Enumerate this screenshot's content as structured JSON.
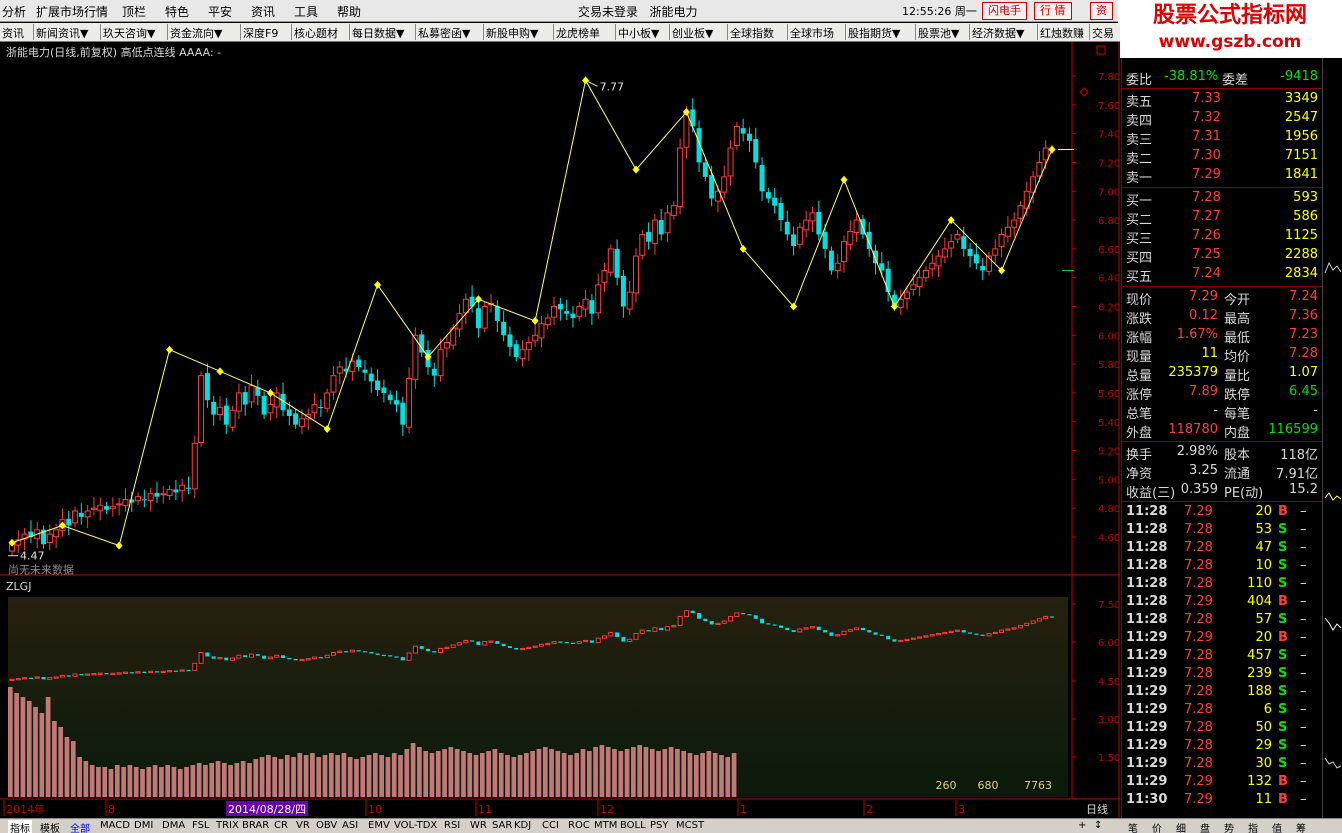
{
  "menu": {
    "items": [
      "分析",
      "扩展市场行情",
      "顶栏",
      "特色",
      "平安",
      "资讯",
      "工具",
      "帮助"
    ],
    "title": "交易未登录",
    "stock": "浙能电力",
    "clock": "12:55:26 周一",
    "btn_flash": "闪电手",
    "btn_quote": "行 情",
    "btn_trade": "资"
  },
  "logo": {
    "line1": "股票公式指标网",
    "line2": "www.gszb.com"
  },
  "tabs": [
    "资讯",
    "新闻资讯▼",
    "玖天咨询▼",
    "资金流向▼",
    "深度F9",
    "核心题材",
    "每日数据▼",
    "私募密函▼",
    "新股申购▼",
    "龙虎榜单",
    "中小板▼",
    "创业板▼",
    "全球指数",
    "全球市场",
    "股指期货▼",
    "股票池▼",
    "经济数据▼",
    "红烛数赚",
    "交易"
  ],
  "chart_info": {
    "title": "浙能电力(日线,前复权) 高低点连线 AAAA: -",
    "high_label": "7.77",
    "low_label": "4.47",
    "no_future": "尚无未来数据",
    "sub_title": "ZLGJ",
    "period": "日线",
    "date_cursor": "2014/08/28/四",
    "sub_vals": [
      "260",
      "680",
      "7763"
    ]
  },
  "axes": {
    "main_ticks": [
      "7.80",
      "7.60",
      "7.40",
      "7.20",
      "7.00",
      "6.80",
      "6.60",
      "6.40",
      "6.20",
      "6.00",
      "5.80",
      "5.60",
      "5.40",
      "5.20",
      "5.00",
      "4.80",
      "4.60"
    ],
    "sub_ticks": [
      "7.50",
      "6.00",
      "4.50",
      "3.00",
      "1.50"
    ],
    "date_labels": [
      "2014年",
      "8",
      "2014/08/28/四",
      "10",
      "11",
      "12",
      "1",
      "2",
      "3"
    ]
  },
  "chart_data": {
    "type": "candlestick",
    "symbol": "浙能电力",
    "ylim": [
      4.4,
      7.9
    ],
    "zigzag": [
      4.56,
      4.68,
      4.54,
      5.9,
      5.75,
      5.6,
      5.35,
      6.35,
      5.85,
      6.25,
      6.1,
      7.77,
      7.15,
      7.55,
      6.6,
      6.2,
      7.08,
      6.2,
      6.8,
      6.45,
      7.29
    ],
    "zigzag_marks": [
      0,
      1,
      2,
      3,
      5,
      7,
      8,
      9,
      10,
      11,
      13,
      14,
      15,
      16,
      17,
      18,
      19
    ],
    "closes": [
      4.55,
      4.58,
      4.62,
      4.6,
      4.65,
      4.55,
      4.62,
      4.65,
      4.72,
      4.68,
      4.78,
      4.74,
      4.78,
      4.8,
      4.82,
      4.79,
      4.81,
      4.83,
      4.86,
      4.84,
      4.88,
      4.86,
      4.9,
      4.88,
      4.9,
      4.93,
      4.91,
      4.96,
      4.94,
      5.25,
      5.72,
      5.55,
      5.45,
      5.5,
      5.38,
      5.48,
      5.6,
      5.52,
      5.65,
      5.58,
      5.45,
      5.52,
      5.6,
      5.48,
      5.44,
      5.38,
      5.42,
      5.45,
      5.52,
      5.5,
      5.6,
      5.72,
      5.78,
      5.75,
      5.82,
      5.78,
      5.74,
      5.68,
      5.62,
      5.6,
      5.55,
      5.52,
      5.38,
      5.7,
      6.0,
      5.88,
      5.78,
      5.72,
      5.9,
      5.95,
      6.05,
      6.15,
      6.25,
      6.2,
      6.05,
      6.2,
      6.22,
      6.1,
      6.0,
      5.92,
      5.85,
      5.9,
      5.95,
      6.0,
      6.08,
      6.12,
      6.2,
      6.18,
      6.15,
      6.12,
      6.2,
      6.25,
      6.15,
      6.35,
      6.45,
      6.6,
      6.4,
      6.2,
      6.3,
      6.55,
      6.7,
      6.65,
      6.8,
      6.7,
      6.85,
      6.9,
      7.3,
      7.55,
      7.45,
      7.2,
      7.1,
      6.95,
      7.0,
      7.1,
      7.3,
      7.45,
      7.4,
      7.35,
      7.2,
      7.0,
      6.95,
      6.9,
      6.8,
      6.7,
      6.62,
      6.75,
      6.8,
      6.85,
      6.7,
      6.6,
      6.45,
      6.5,
      6.65,
      6.72,
      6.8,
      6.7,
      6.6,
      6.5,
      6.45,
      6.3,
      6.2,
      6.25,
      6.3,
      6.35,
      6.4,
      6.45,
      6.5,
      6.55,
      6.6,
      6.65,
      6.7,
      6.6,
      6.55,
      6.5,
      6.45,
      6.55,
      6.6,
      6.7,
      6.75,
      6.8,
      6.9,
      7.0,
      7.1,
      7.2,
      7.3,
      7.29
    ],
    "sub_bars": [
      0.55,
      0.52,
      0.5,
      0.48,
      0.45,
      0.42,
      0.5,
      0.38,
      0.35,
      0.3,
      0.28,
      0.2,
      0.18,
      0.16,
      0.15,
      0.15,
      0.14,
      0.16,
      0.15,
      0.16,
      0.15,
      0.14,
      0.15,
      0.16,
      0.15,
      0.16,
      0.15,
      0.14,
      0.15,
      0.16,
      0.17,
      0.16,
      0.17,
      0.18,
      0.17,
      0.16,
      0.17,
      0.18,
      0.17,
      0.19,
      0.2,
      0.21,
      0.2,
      0.19,
      0.21,
      0.2,
      0.22,
      0.21,
      0.22,
      0.2,
      0.21,
      0.22,
      0.21,
      0.22,
      0.2,
      0.19,
      0.2,
      0.21,
      0.22,
      0.21,
      0.2,
      0.22,
      0.21,
      0.24,
      0.27,
      0.25,
      0.23,
      0.22,
      0.23,
      0.24,
      0.25,
      0.24,
      0.23,
      0.22,
      0.21,
      0.22,
      0.23,
      0.24,
      0.22,
      0.21,
      0.2,
      0.21,
      0.22,
      0.23,
      0.24,
      0.25,
      0.24,
      0.23,
      0.22,
      0.21,
      0.22,
      0.24,
      0.23,
      0.25,
      0.26,
      0.25,
      0.24,
      0.23,
      0.24,
      0.25,
      0.26,
      0.25,
      0.24,
      0.23,
      0.24,
      0.25,
      0.24,
      0.23,
      0.22,
      0.21,
      0.22,
      0.23,
      0.22,
      0.21,
      0.2,
      0.22
    ]
  },
  "quote": {
    "wb": {
      "label": "委比",
      "value": "-38.81%",
      "diff_label": "委差",
      "diff": "-9418"
    },
    "sells": [
      {
        "name": "卖五",
        "price": "7.33",
        "vol": "3349"
      },
      {
        "name": "卖四",
        "price": "7.32",
        "vol": "2547"
      },
      {
        "name": "卖三",
        "price": "7.31",
        "vol": "1956"
      },
      {
        "name": "卖二",
        "price": "7.30",
        "vol": "7151"
      },
      {
        "name": "卖一",
        "price": "7.29",
        "vol": "1841"
      }
    ],
    "buys": [
      {
        "name": "买一",
        "price": "7.28",
        "vol": "593"
      },
      {
        "name": "买二",
        "price": "7.27",
        "vol": "586"
      },
      {
        "name": "买三",
        "price": "7.26",
        "vol": "1125"
      },
      {
        "name": "买四",
        "price": "7.25",
        "vol": "2288"
      },
      {
        "name": "买五",
        "price": "7.24",
        "vol": "2834"
      }
    ],
    "stats": [
      [
        "现价",
        "7.29",
        "今开",
        "7.24"
      ],
      [
        "涨跌",
        "0.12",
        "最高",
        "7.36"
      ],
      [
        "涨幅",
        "1.67%",
        "最低",
        "7.23"
      ],
      [
        "现量",
        "11",
        "均价",
        "7.28"
      ],
      [
        "总量",
        "235379",
        "量比",
        "1.07"
      ],
      [
        "涨停",
        "7.89",
        "跌停",
        "6.45"
      ],
      [
        "总笔",
        "-",
        "每笔",
        "-"
      ],
      [
        "外盘",
        "118780",
        "内盘",
        "116599"
      ]
    ],
    "fund": [
      [
        "换手",
        "2.98%",
        "股本",
        "118亿"
      ],
      [
        "净资",
        "3.25",
        "流通",
        "7.91亿"
      ],
      [
        "收益(三)",
        "0.359",
        "PE(动)",
        "15.2"
      ]
    ],
    "ticks": [
      [
        "11:28",
        "7.29",
        "20",
        "B"
      ],
      [
        "11:28",
        "7.28",
        "53",
        "S"
      ],
      [
        "11:28",
        "7.28",
        "47",
        "S"
      ],
      [
        "11:28",
        "7.28",
        "10",
        "S"
      ],
      [
        "11:28",
        "7.28",
        "110",
        "S"
      ],
      [
        "11:28",
        "7.29",
        "404",
        "B"
      ],
      [
        "11:28",
        "7.28",
        "57",
        "S"
      ],
      [
        "11:29",
        "7.29",
        "20",
        "B"
      ],
      [
        "11:29",
        "7.28",
        "457",
        "S"
      ],
      [
        "11:29",
        "7.28",
        "239",
        "S"
      ],
      [
        "11:29",
        "7.28",
        "188",
        "S"
      ],
      [
        "11:29",
        "7.28",
        "6",
        "S"
      ],
      [
        "11:29",
        "7.28",
        "50",
        "S"
      ],
      [
        "11:29",
        "7.28",
        "29",
        "S"
      ],
      [
        "11:29",
        "7.28",
        "30",
        "S"
      ],
      [
        "11:29",
        "7.29",
        "132",
        "B"
      ],
      [
        "11:30",
        "7.29",
        "11",
        "B"
      ]
    ]
  },
  "bottom_tabs": [
    "指标",
    "模板",
    "全部",
    "MACD",
    "DMI",
    "DMA",
    "FSL",
    "TRIX",
    "BRAR",
    "CR",
    "VR",
    "OBV",
    "ASI",
    "EMV",
    "VOL-TDX",
    "RSI",
    "WR",
    "SAR",
    "KDJ",
    "CCI",
    "ROC",
    "MTM",
    "BOLL",
    "PSY",
    "MCST"
  ],
  "bottom_right": [
    "笔",
    "价",
    "细",
    "盘",
    "势",
    "指",
    "值",
    "筹"
  ],
  "colors": {
    "up": "#ff3c3c",
    "down": "#00e0e0",
    "zig": "#ffff66",
    "marker": "#ffff00",
    "axis": "#c00000"
  }
}
